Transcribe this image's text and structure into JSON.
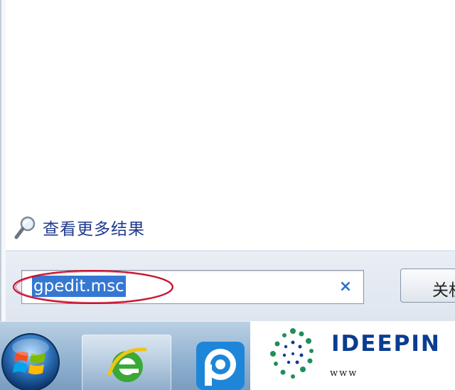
{
  "start_menu": {
    "see_more_label": "查看更多结果",
    "search": {
      "value": "gpedit.msc",
      "clear_glyph": "×"
    },
    "shutdown_label": "关机"
  },
  "taskbar": {
    "start_orb_icon": "windows-logo-icon",
    "pinned": [
      {
        "name": "ie-icon",
        "active": true
      },
      {
        "name": "pptv-icon",
        "active": false
      }
    ]
  },
  "watermark": {
    "brand": "IDEEPIN",
    "url": "www"
  },
  "colors": {
    "highlight": "#3478d3",
    "annotation": "#c8102e",
    "link_text": "#1e3a8a"
  }
}
